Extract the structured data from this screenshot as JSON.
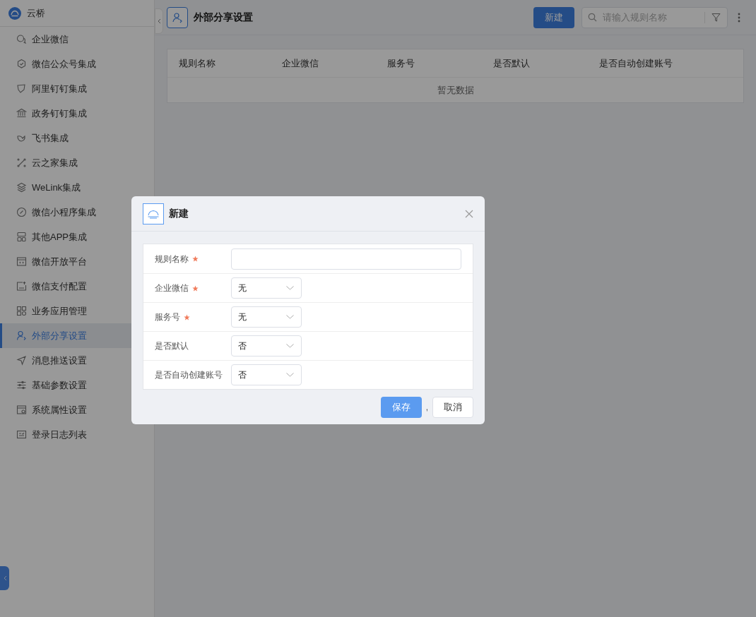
{
  "sidebar": {
    "app_name": "云桥",
    "items": [
      {
        "label": "企业微信",
        "selected": false
      },
      {
        "label": "微信公众号集成",
        "selected": false
      },
      {
        "label": "阿里钉钉集成",
        "selected": false
      },
      {
        "label": "政务钉钉集成",
        "selected": false
      },
      {
        "label": "飞书集成",
        "selected": false
      },
      {
        "label": "云之家集成",
        "selected": false
      },
      {
        "label": "WeLink集成",
        "selected": false
      },
      {
        "label": "微信小程序集成",
        "selected": false
      },
      {
        "label": "其他APP集成",
        "selected": false
      },
      {
        "label": "微信开放平台",
        "selected": false
      },
      {
        "label": "微信支付配置",
        "selected": false
      },
      {
        "label": "业务应用管理",
        "selected": false
      },
      {
        "label": "外部分享设置",
        "selected": true
      },
      {
        "label": "消息推送设置",
        "selected": false
      },
      {
        "label": "基础参数设置",
        "selected": false
      },
      {
        "label": "系统属性设置",
        "selected": false
      },
      {
        "label": "登录日志列表",
        "selected": false
      }
    ]
  },
  "header": {
    "title": "外部分享设置",
    "new_button": "新建",
    "search": {
      "placeholder": "请输入规则名称"
    }
  },
  "table": {
    "columns": [
      "规则名称",
      "企业微信",
      "服务号",
      "是否默认",
      "是否自动创建账号"
    ],
    "empty_text": "暂无数据"
  },
  "dialog": {
    "title": "新建",
    "fields": [
      {
        "label": "规则名称",
        "required": true,
        "kind": "text"
      },
      {
        "label": "企业微信",
        "required": true,
        "kind": "select",
        "value": "无"
      },
      {
        "label": "服务号",
        "required": true,
        "kind": "select",
        "value": "无"
      },
      {
        "label": "是否默认",
        "required": false,
        "kind": "select",
        "value": "否"
      },
      {
        "label": "是否自动创建账号",
        "required": false,
        "kind": "select",
        "value": "否"
      }
    ],
    "save_button": "保存",
    "separator": ",",
    "cancel_button": "取消"
  }
}
